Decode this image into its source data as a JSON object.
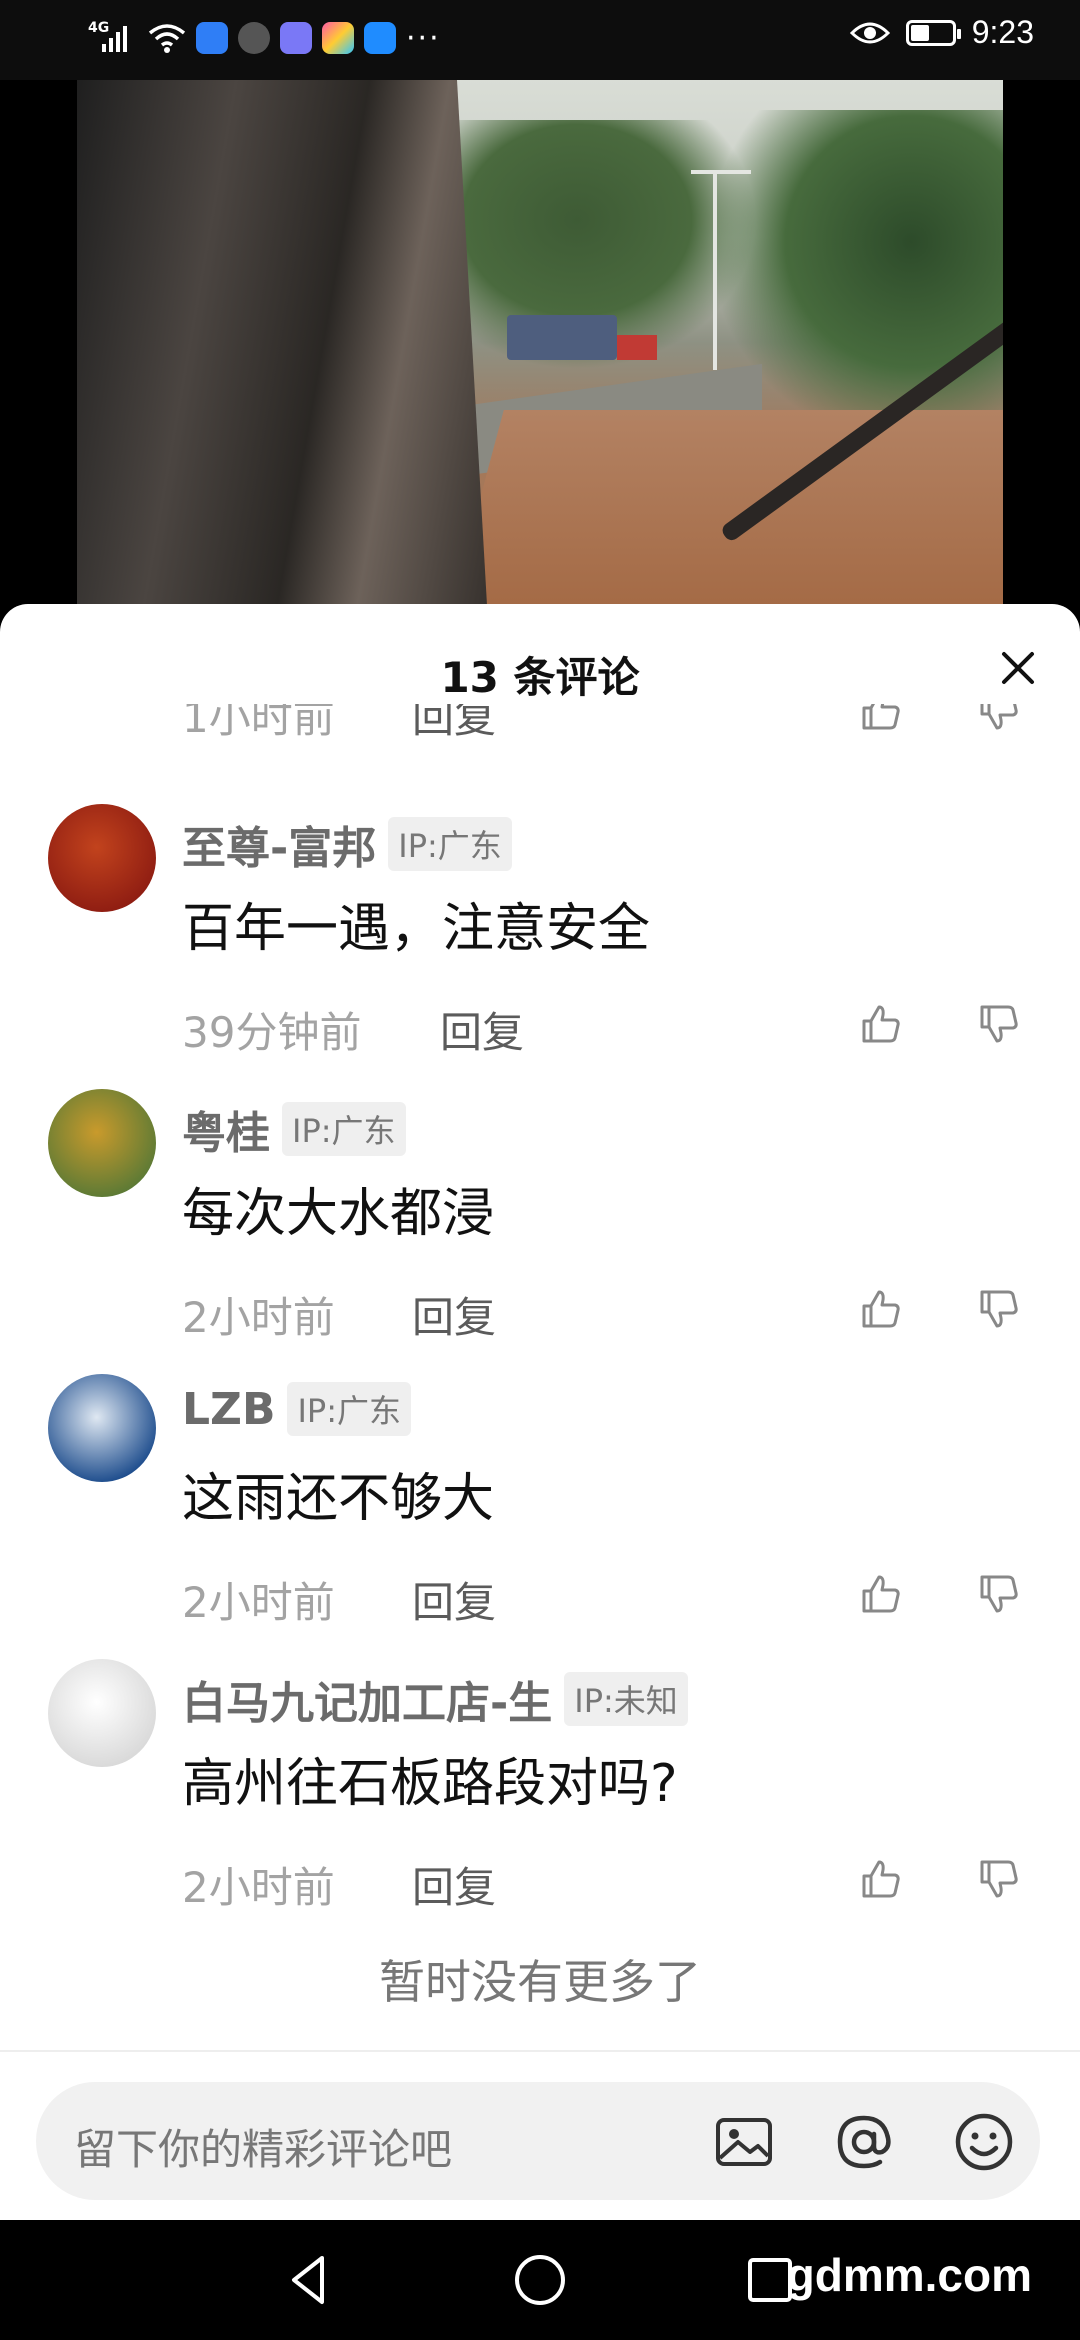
{
  "status_bar": {
    "network": "4G",
    "time": "9:23",
    "battery_level": 0.45,
    "icons": [
      "signal-icon",
      "wifi-icon",
      "shield-app-icon",
      "clock-app-icon",
      "music-app-icon",
      "puzzle-app-icon",
      "cloud-app-icon",
      "more-dots-icon",
      "eye-icon",
      "battery-icon"
    ],
    "more": "···"
  },
  "sheet": {
    "title": "13 条评论",
    "close_icon": "close-icon"
  },
  "partial": {
    "time": "1小时前",
    "reply": "回复"
  },
  "comments": [
    {
      "name": "至尊-富邦",
      "ip": "IP:广东",
      "text": "百年一遇，注意安全",
      "time": "39分钟前",
      "reply": "回复",
      "avatar_colors": [
        "#8f1d12",
        "#c2431d"
      ]
    },
    {
      "name": "粤桂",
      "ip": "IP:广东",
      "text": "每次大水都浸",
      "time": "2小时前",
      "reply": "回复",
      "avatar_colors": [
        "#5c7a35",
        "#c99a2c"
      ]
    },
    {
      "name": "LZB",
      "ip": "IP:广东",
      "text": "这雨还不够大",
      "time": "2小时前",
      "reply": "回复",
      "avatar_colors": [
        "#1e4d8d",
        "#dfe8f2"
      ]
    },
    {
      "name": "白马九记加工店-生",
      "ip": "IP:未知",
      "text": "高州往石板路段对吗?",
      "time": "2小时前",
      "reply": "回复",
      "avatar_colors": [
        "#d9d9d9",
        "#ffffff"
      ]
    }
  ],
  "footer": {
    "no_more": "暂时没有更多了"
  },
  "input": {
    "placeholder": "留下你的精彩评论吧",
    "icons": [
      "image-icon",
      "at-icon",
      "emoji-icon"
    ]
  },
  "nav": {
    "icons": [
      "back-icon",
      "home-icon",
      "recents-icon"
    ],
    "watermark": "gdmm.com"
  },
  "colors": {
    "accent": "#111111",
    "muted": "#a3a3a3",
    "ip_bg": "#efefef"
  }
}
